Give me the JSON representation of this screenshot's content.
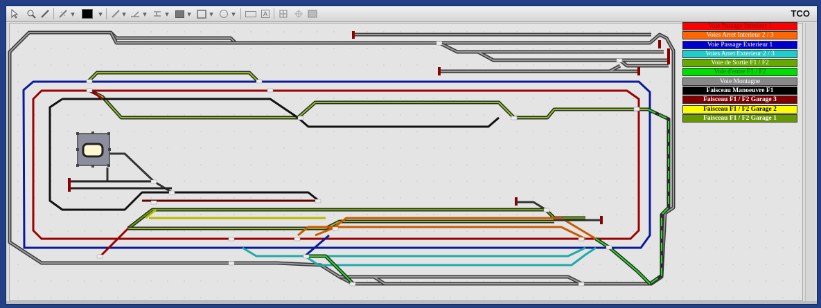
{
  "window": {
    "title": "TCO"
  },
  "toolbar": {
    "tools": [
      {
        "name": "select-tool",
        "glyph": ""
      },
      {
        "name": "zoom-tool",
        "glyph": ""
      },
      {
        "name": "pencil-tool",
        "glyph": ""
      },
      {
        "name": "rail-tool",
        "glyph": ""
      },
      {
        "name": "color-swatch",
        "glyph": ""
      },
      {
        "name": "pen-tool",
        "glyph": ""
      },
      {
        "name": "turnout-tool",
        "glyph": ""
      },
      {
        "name": "signal-tool",
        "glyph": ""
      },
      {
        "name": "block-tool",
        "glyph": ""
      },
      {
        "name": "frame-tool",
        "glyph": ""
      },
      {
        "name": "circle-tool",
        "glyph": ""
      },
      {
        "name": "keyboard-tool",
        "glyph": ""
      },
      {
        "name": "text-tool",
        "glyph": "A"
      },
      {
        "name": "grid-tool",
        "glyph": ""
      },
      {
        "name": "image-tool",
        "glyph": ""
      },
      {
        "name": "picture-tool",
        "glyph": ""
      }
    ],
    "current_color": "#000000"
  },
  "legend": [
    {
      "label": "Voie Passage Interieur 1",
      "bg": "#ff0000",
      "fg": "#8b0000"
    },
    {
      "label": "Voies Arret Interieur 2 / 3",
      "bg": "#ff6600",
      "fg": "#ffffff"
    },
    {
      "label": "Voie Passage Exterieur 1",
      "bg": "#0000cc",
      "fg": "#ffffff"
    },
    {
      "label": "Voies Arret Exterieur 2 / 3",
      "bg": "#22cccc",
      "fg": "#ffffff"
    },
    {
      "label": "Voie de Sortie F1 / F2",
      "bg": "#66aa00",
      "fg": "#ffffff"
    },
    {
      "label": "Voie d'entre F1 / F2",
      "bg": "#00dd00",
      "fg": "#006600"
    },
    {
      "label": "Voie Montagne",
      "bg": "#888888",
      "fg": "#ffffff"
    },
    {
      "label": "Faisceau Manoeuvre F1",
      "bg": "#000000",
      "fg": "#ffffff"
    },
    {
      "label": "Faisceau F1 / F2 Garage 3",
      "bg": "#800000",
      "fg": "#ffffff"
    },
    {
      "label": "Faisceau F1 / F2 Garage 2",
      "bg": "#ffff00",
      "fg": "#000000"
    },
    {
      "label": "Faisceau F1 / F2 Garage 1",
      "bg": "#669900",
      "fg": "#ffffff"
    }
  ]
}
